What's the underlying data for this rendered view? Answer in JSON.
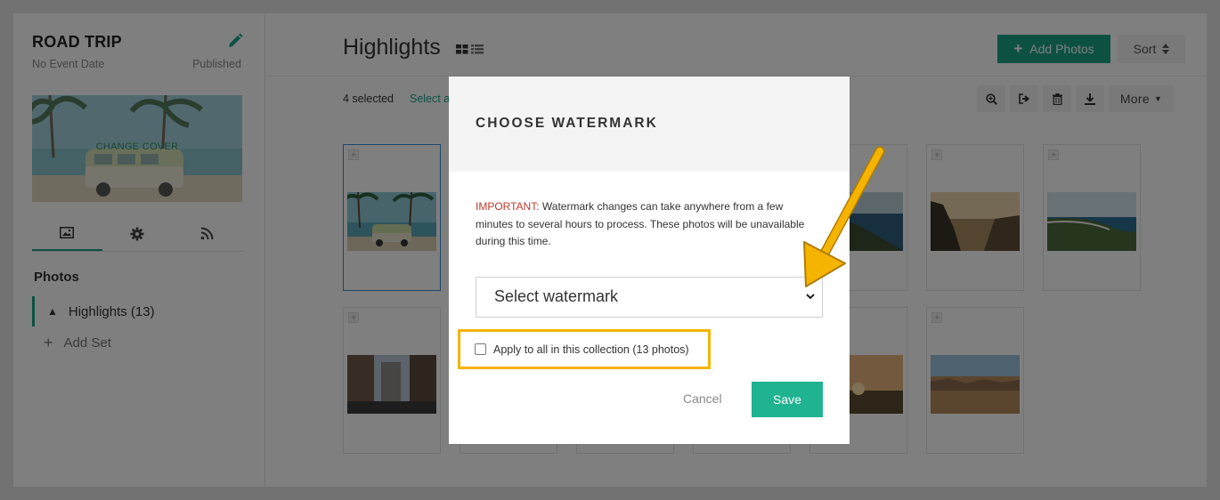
{
  "sidebar": {
    "collection_title": "ROAD TRIP",
    "event_date": "No Event Date",
    "status": "Published",
    "change_cover_label": "CHANGE COVER",
    "photos_heading": "Photos",
    "sets": [
      {
        "label": "Highlights (13)"
      }
    ],
    "add_set_label": "Add Set",
    "tabs": [
      {
        "icon": "image-icon",
        "active": true
      },
      {
        "icon": "gear-icon",
        "active": false
      },
      {
        "icon": "rss-icon",
        "active": false
      }
    ]
  },
  "main": {
    "title": "Highlights",
    "add_photos_label": "Add Photos",
    "sort_label": "Sort",
    "selected_count": "4 selected",
    "select_all_label": "Select a",
    "toolbar": {
      "icons": [
        "zoom-in-icon",
        "share-icon",
        "trash-icon",
        "download-icon"
      ],
      "more_label": "More"
    },
    "grid_rows": [
      [
        {
          "image": "beach-van",
          "selected": true
        },
        {
          "image": "hidden",
          "selected": false
        },
        {
          "image": "hidden",
          "selected": false
        },
        {
          "image": "hidden",
          "selected": false
        },
        {
          "image": "coast-cliffs",
          "selected": false
        },
        {
          "image": "sunlit-cliff",
          "selected": false
        },
        {
          "image": "ocean-coast",
          "selected": false
        }
      ],
      [
        {
          "image": "city-street",
          "selected": false
        },
        {
          "image": "hidden",
          "selected": false
        },
        {
          "image": "hidden",
          "selected": false
        },
        {
          "image": "hidden",
          "selected": false
        },
        {
          "image": "sunset-field",
          "selected": false
        },
        {
          "image": "desert-valley",
          "selected": false
        }
      ]
    ]
  },
  "modal": {
    "title": "CHOOSE WATERMARK",
    "important_label": "IMPORTANT:",
    "important_text": " Watermark changes can take anywhere from a few minutes to several hours to process. These photos will be unavailable during this time.",
    "select_placeholder": "Select watermark",
    "apply_all_label": "Apply to all in this collection (13 photos)",
    "apply_all_checked": false,
    "cancel_label": "Cancel",
    "save_label": "Save"
  },
  "colors": {
    "accent": "#1aa287",
    "highlight": "#f5b400",
    "warning": "#c0392b"
  }
}
